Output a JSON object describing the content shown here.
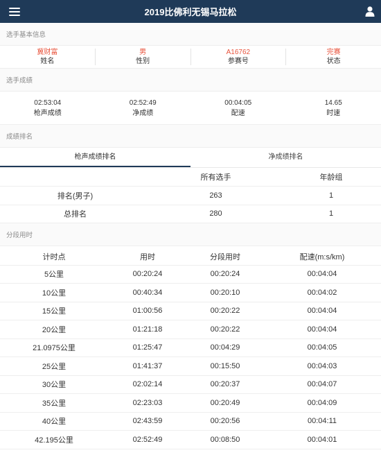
{
  "header": {
    "title": "2019比佛利无锡马拉松"
  },
  "sections": {
    "basic_info": "选手基本信息",
    "results": "选手成绩",
    "ranking": "成绩排名",
    "splits": "分段用时"
  },
  "basic_info": [
    {
      "value": "冀财富",
      "label": "姓名"
    },
    {
      "value": "男",
      "label": "性别"
    },
    {
      "value": "A16762",
      "label": "参赛号"
    },
    {
      "value": "完赛",
      "label": "状态"
    }
  ],
  "results": [
    {
      "value": "02:53:04",
      "label": "枪声成绩"
    },
    {
      "value": "02:52:49",
      "label": "净成绩"
    },
    {
      "value": "00:04:05",
      "label": "配速"
    },
    {
      "value": "14.65",
      "label": "时速"
    }
  ],
  "ranking_tabs": [
    {
      "label": "枪声成绩排名",
      "active": true
    },
    {
      "label": "净成绩排名",
      "active": false
    }
  ],
  "ranking_table": {
    "headers": [
      "",
      "所有选手",
      "年龄组"
    ],
    "rows": [
      [
        "排名(男子)",
        "263",
        "1"
      ],
      [
        "总排名",
        "280",
        "1"
      ]
    ]
  },
  "splits_table": {
    "headers": [
      "计时点",
      "用时",
      "分段用时",
      "配速(m:s/km)"
    ],
    "rows": [
      [
        "5公里",
        "00:20:24",
        "00:20:24",
        "00:04:04"
      ],
      [
        "10公里",
        "00:40:34",
        "00:20:10",
        "00:04:02"
      ],
      [
        "15公里",
        "01:00:56",
        "00:20:22",
        "00:04:04"
      ],
      [
        "20公里",
        "01:21:18",
        "00:20:22",
        "00:04:04"
      ],
      [
        "21.0975公里",
        "01:25:47",
        "00:04:29",
        "00:04:05"
      ],
      [
        "25公里",
        "01:41:37",
        "00:15:50",
        "00:04:03"
      ],
      [
        "30公里",
        "02:02:14",
        "00:20:37",
        "00:04:07"
      ],
      [
        "35公里",
        "02:23:03",
        "00:20:49",
        "00:04:09"
      ],
      [
        "40公里",
        "02:43:59",
        "00:20:56",
        "00:04:11"
      ],
      [
        "42.195公里",
        "02:52:49",
        "00:08:50",
        "00:04:01"
      ]
    ]
  },
  "icons": {
    "menu": "hamburger-menu-icon",
    "user": "user-icon"
  },
  "colors": {
    "header_bg": "#1f3a58",
    "highlight": "#e8543d"
  }
}
